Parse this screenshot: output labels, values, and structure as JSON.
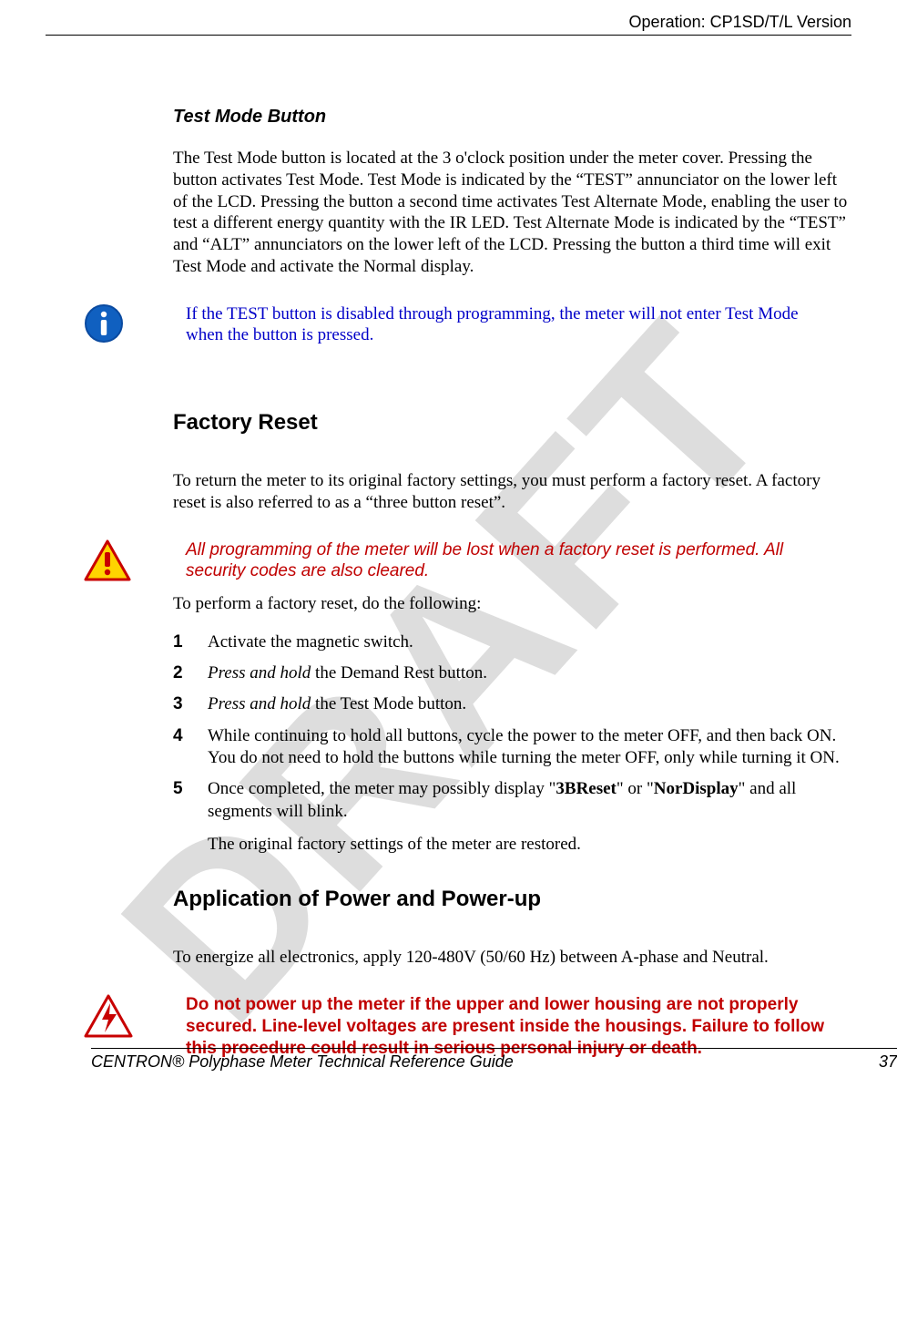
{
  "header": {
    "right": "Operation: CP1SD/T/L Version"
  },
  "watermark": "DRAFT",
  "section1": {
    "heading": "Test Mode Button",
    "para": "The Test Mode button is located at the 3 o'clock position under the meter cover. Pressing the button activates Test Mode. Test Mode is indicated by the “TEST” annunciator on the lower left of the LCD. Pressing the button a second time activates Test Alternate Mode, enabling the user to test a different energy quantity with the IR LED. Test Alternate Mode is indicated by the “TEST” and “ALT” annunciators on the lower left of the LCD. Pressing the button a third time will exit Test Mode and activate the Normal display.",
    "note": "If the TEST button is disabled through programming, the meter will not enter Test Mode when the button is pressed."
  },
  "section2": {
    "heading": "Factory Reset",
    "intro": "To return the meter to its original factory settings, you must perform a factory reset.  A factory reset is also referred to as a “three button reset”.",
    "warning": "All programming of the meter will be lost when a factory reset is performed. All security codes are also cleared.",
    "lead": "To perform a factory reset, do the following:",
    "steps": {
      "s1": "Activate the magnetic switch.",
      "s2_a": "Press and hold",
      "s2_b": " the Demand Rest button.",
      "s3_a": "Press and hold",
      "s3_b": " the Test Mode button.",
      "s4": "While continuing to hold all buttons, cycle the power to the meter OFF, and then back ON. You do not need to hold the buttons while turning the meter OFF, only while turning it ON.",
      "s5_a": "Once completed, the meter may possibly display \"",
      "s5_b": "3BReset",
      "s5_c": "\" or \"",
      "s5_d": "NorDisplay",
      "s5_e": "\" and all segments will blink.",
      "s5_after": "The original factory settings of the meter are restored."
    }
  },
  "section3": {
    "heading": "Application of Power and Power-up",
    "para": "To energize all electronics, apply 120-480V (50/60 Hz) between A-phase and Neutral.",
    "danger": "Do not power up the meter if the upper and lower housing are not properly secured. Line-level voltages  are present inside the housings. Failure to follow this procedure could result in serious personal injury or death."
  },
  "footer": {
    "left": "CENTRON® Polyphase Meter Technical Reference Guide",
    "right": "37"
  }
}
